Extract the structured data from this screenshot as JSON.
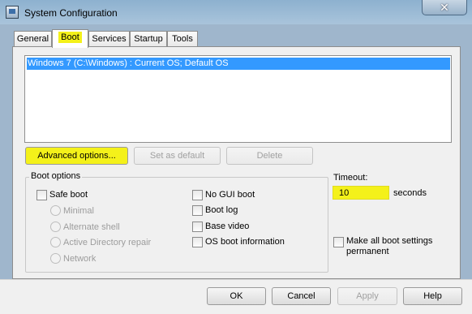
{
  "window": {
    "title": "System Configuration",
    "close": "✕"
  },
  "tabs": [
    {
      "label": "General"
    },
    {
      "label": "Boot"
    },
    {
      "label": "Services"
    },
    {
      "label": "Startup"
    },
    {
      "label": "Tools"
    }
  ],
  "os_list": [
    "Windows 7 (C:\\Windows) : Current OS; Default OS"
  ],
  "os_buttons": {
    "advanced": "Advanced options...",
    "set_default": "Set as default",
    "delete": "Delete"
  },
  "boot_options": {
    "title": "Boot options",
    "safe_boot": "Safe boot",
    "minimal": "Minimal",
    "alternate_shell": "Alternate shell",
    "ad_repair": "Active Directory repair",
    "network": "Network",
    "no_gui_boot": "No GUI boot",
    "boot_log": "Boot log",
    "base_video": "Base video",
    "os_boot_info": "OS boot information"
  },
  "timeout": {
    "label": "Timeout:",
    "value": "10",
    "unit": "seconds"
  },
  "permanent": {
    "line1": "Make all boot settings",
    "line2": "permanent"
  },
  "footer": {
    "ok": "OK",
    "cancel": "Cancel",
    "apply": "Apply",
    "help": "Help"
  },
  "colors": {
    "highlight": "#f4f11a",
    "selection": "#3399ff"
  }
}
